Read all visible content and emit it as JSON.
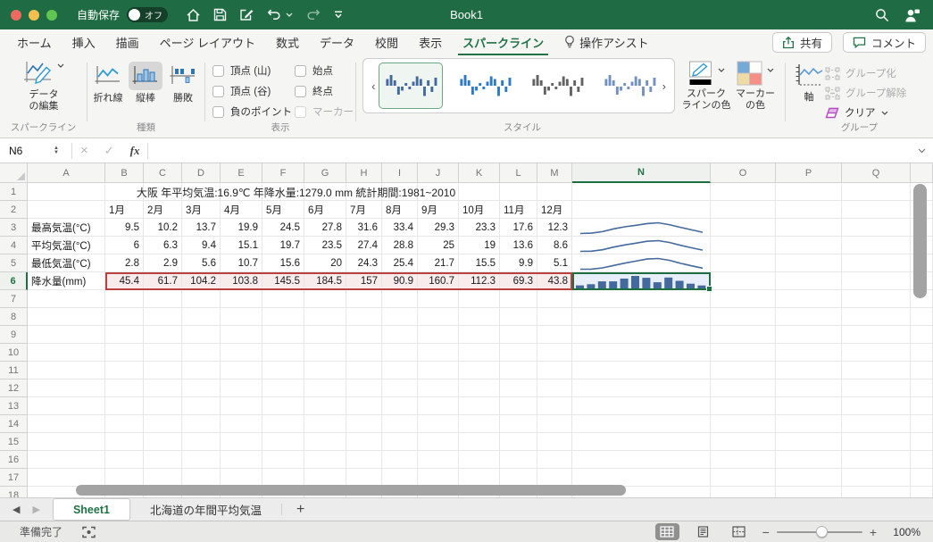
{
  "titlebar": {
    "autosave_label": "自動保存",
    "autosave_state": "オフ",
    "title": "Book1"
  },
  "menu_tabs": {
    "items": [
      {
        "label": "ホーム",
        "active": false
      },
      {
        "label": "挿入",
        "active": false
      },
      {
        "label": "描画",
        "active": false
      },
      {
        "label": "ページ レイアウト",
        "active": false
      },
      {
        "label": "数式",
        "active": false
      },
      {
        "label": "データ",
        "active": false
      },
      {
        "label": "校閲",
        "active": false
      },
      {
        "label": "表示",
        "active": false
      },
      {
        "label": "スパークライン",
        "active": true
      },
      {
        "label": "操作アシスト",
        "active": false,
        "icon": "lightbulb"
      }
    ],
    "share_label": "共有",
    "comment_label": "コメント"
  },
  "ribbon": {
    "sparkline_group": {
      "label": "スパークライン",
      "edit_data_line1": "データ",
      "edit_data_line2": "の編集"
    },
    "type_group": {
      "label": "種類",
      "buttons": [
        {
          "label": "折れ線",
          "selected": false
        },
        {
          "label": "縦棒",
          "selected": true
        },
        {
          "label": "勝敗",
          "selected": false
        }
      ]
    },
    "show_group": {
      "label": "表示",
      "checkboxes": [
        {
          "label": "頂点 (山)",
          "checked": false,
          "disabled": false
        },
        {
          "label": "頂点 (谷)",
          "checked": false,
          "disabled": false
        },
        {
          "label": "負のポイント",
          "checked": false,
          "disabled": false
        },
        {
          "label": "始点",
          "checked": false,
          "disabled": false
        },
        {
          "label": "終点",
          "checked": false,
          "disabled": false
        },
        {
          "label": "マーカー",
          "checked": false,
          "disabled": true
        }
      ]
    },
    "style_group": {
      "label": "スタイル",
      "preview_pattern": [
        5,
        8,
        4,
        -6,
        -3,
        2,
        -2,
        3,
        7,
        5,
        -7,
        4,
        -4,
        6
      ],
      "styles": [
        {
          "color": "#44699d",
          "selected": true
        },
        {
          "color": "#2d7ac7",
          "selected": false
        },
        {
          "color": "#636363",
          "selected": false
        },
        {
          "color": "#7291c1",
          "selected": false
        }
      ]
    },
    "color_buttons": {
      "sparkline_color_line1": "スパーク",
      "sparkline_color_line2": "ラインの色",
      "marker_color_line1": "マーカー",
      "marker_color_line2": "の色"
    },
    "group_group": {
      "label": "グループ",
      "axis_label": "軸",
      "group_label": "グループ化",
      "ungroup_label": "グループ解除",
      "clear_label": "クリア"
    }
  },
  "formula_bar": {
    "name_box": "N6",
    "fx_label": "fx"
  },
  "sheet": {
    "columns": [
      "A",
      "B",
      "C",
      "D",
      "E",
      "F",
      "G",
      "H",
      "I",
      "J",
      "K",
      "L",
      "M",
      "N",
      "O",
      "P",
      "Q"
    ],
    "visible_rows": 18,
    "selected_cell": "N6",
    "title_row_text": "大阪 年平均気温:16.9℃ 年降水量:1279.0 mm 統計期間:1981~2010",
    "months": [
      "1月",
      "2月",
      "3月",
      "4月",
      "5月",
      "6月",
      "7月",
      "8月",
      "9月",
      "10月",
      "11月",
      "12月"
    ],
    "data_rows": [
      {
        "label": "最高気温(°C)",
        "sparkline": "line",
        "highlighted": false,
        "values": [
          "9.5",
          "10.2",
          "13.7",
          "19.9",
          "24.5",
          "27.8",
          "31.6",
          "33.4",
          "29.3",
          "23.3",
          "17.6",
          "12.3"
        ]
      },
      {
        "label": "平均気温(°C)",
        "sparkline": "line",
        "highlighted": false,
        "values": [
          "6",
          "6.3",
          "9.4",
          "15.1",
          "19.7",
          "23.5",
          "27.4",
          "28.8",
          "25",
          "19",
          "13.6",
          "8.6"
        ]
      },
      {
        "label": "最低気温(°C)",
        "sparkline": "line",
        "highlighted": false,
        "values": [
          "2.8",
          "2.9",
          "5.6",
          "10.7",
          "15.6",
          "20",
          "24.3",
          "25.4",
          "21.7",
          "15.5",
          "9.9",
          "5.1"
        ]
      },
      {
        "label": "降水量(mm)",
        "sparkline": "column",
        "highlighted": true,
        "values": [
          "45.4",
          "61.7",
          "104.2",
          "103.8",
          "145.5",
          "184.5",
          "157",
          "90.9",
          "160.7",
          "112.3",
          "69.3",
          "43.8"
        ]
      }
    ]
  },
  "sheet_tabs": {
    "tabs": [
      {
        "label": "Sheet1",
        "active": true
      },
      {
        "label": "北海道の年間平均気温",
        "active": false
      }
    ],
    "add_label": "+"
  },
  "status_bar": {
    "ready_label": "準備完了",
    "zoom_level": "100%"
  },
  "icons": {
    "cancel": "×",
    "check": "✓",
    "nav_left": "◀",
    "nav_right": "▶",
    "step_up": "▲",
    "step_down": "▼",
    "gallery_prev": "‹",
    "gallery_next": "›",
    "minus": "−",
    "plus": "+"
  },
  "colors": {
    "accent_green": "#217346",
    "titlebar_green": "#1f6c44",
    "sparkline_blue": "#44699d",
    "selection_green": "#1d6f42",
    "range_red_border": "#b9413f",
    "range_red_fill": "#f8ecec"
  }
}
